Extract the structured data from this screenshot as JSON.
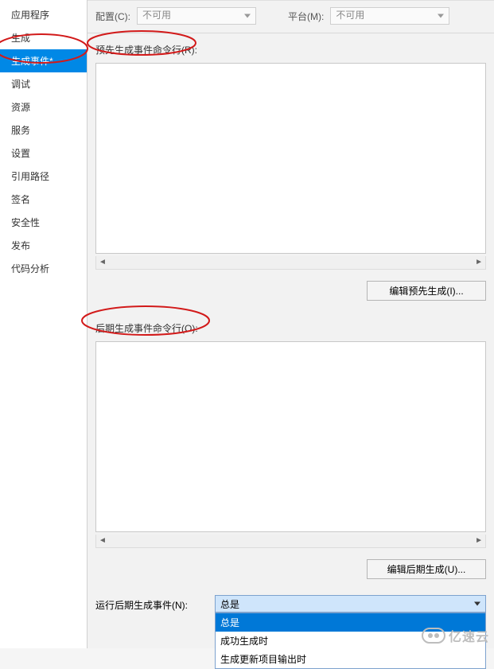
{
  "sidebar": {
    "items": [
      {
        "label": "应用程序"
      },
      {
        "label": "生成"
      },
      {
        "label": "生成事件*",
        "selected": true
      },
      {
        "label": "调试"
      },
      {
        "label": "资源"
      },
      {
        "label": "服务"
      },
      {
        "label": "设置"
      },
      {
        "label": "引用路径"
      },
      {
        "label": "签名"
      },
      {
        "label": "安全性"
      },
      {
        "label": "发布"
      },
      {
        "label": "代码分析"
      }
    ]
  },
  "top": {
    "config_label": "配置(C):",
    "config_value": "不可用",
    "platform_label": "平台(M):",
    "platform_value": "不可用"
  },
  "prebuild": {
    "label": "预先生成事件命令行(R):",
    "value": "",
    "button": "编辑预先生成(I)..."
  },
  "postbuild": {
    "label": "后期生成事件命令行(O):",
    "value": "",
    "button": "编辑后期生成(U)..."
  },
  "run": {
    "label": "运行后期生成事件(N):",
    "selected": "总是",
    "options": [
      "总是",
      "成功生成时",
      "生成更新项目输出时"
    ]
  },
  "watermark": {
    "text": "亿速云"
  },
  "colors": {
    "accent": "#0088e6",
    "dropdown_hl": "#0078d7",
    "annotation": "#d21a1a"
  }
}
